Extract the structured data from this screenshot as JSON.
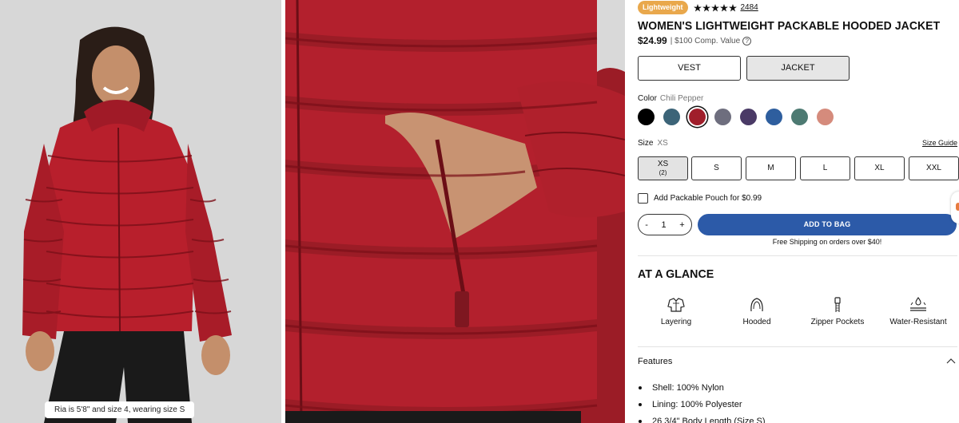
{
  "gallery": {
    "model_caption": "Ria is 5'8\" and size 4, wearing size S"
  },
  "product": {
    "badge": "Lightweight",
    "rating_stars": 5,
    "review_count": "2484",
    "title": "WOMEN'S LIGHTWEIGHT PACKABLE HOODED JACKET",
    "price": "$24.99",
    "comp_value": "| $100 Comp. Value",
    "style_options": [
      "VEST",
      "JACKET"
    ],
    "selected_style": "JACKET"
  },
  "color": {
    "label": "Color",
    "selected": "Chili Pepper",
    "swatches": [
      "#000000",
      "#3c6478",
      "#a01e2b",
      "#6e6e7e",
      "#4a3a66",
      "#2e5e9e",
      "#4d7a72",
      "#d58b7c"
    ]
  },
  "size": {
    "label": "Size",
    "selected": "XS",
    "guide_link": "Size Guide",
    "options": [
      {
        "label": "XS",
        "sub": "(2)"
      },
      {
        "label": "S"
      },
      {
        "label": "M"
      },
      {
        "label": "L"
      },
      {
        "label": "XL"
      },
      {
        "label": "XXL"
      }
    ]
  },
  "add_on": {
    "pouch_label": "Add Packable Pouch for $0.99"
  },
  "cart": {
    "minus": "-",
    "quantity": "1",
    "plus": "+",
    "add_button": "ADD TO BAG",
    "shipping_note": "Free Shipping on orders over $40!"
  },
  "glance": {
    "title": "AT A GLANCE",
    "items": [
      {
        "label": "Layering",
        "icon": "layering-icon"
      },
      {
        "label": "Hooded",
        "icon": "hood-icon"
      },
      {
        "label": "Zipper Pockets",
        "icon": "zipper-icon"
      },
      {
        "label": "Water-Resistant",
        "icon": "water-resistant-icon"
      }
    ]
  },
  "features": {
    "label": "Features",
    "items": [
      "Shell: 100% Nylon",
      "Lining: 100% Polyester",
      "26 3/4\" Body Length (Size S)"
    ]
  },
  "colors": {
    "badge": "#e9a84c",
    "add_to_bag": "#2c5aa8",
    "jacket": "#b81f2c"
  }
}
